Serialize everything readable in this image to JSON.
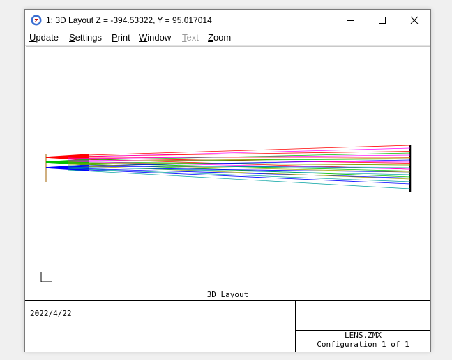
{
  "window": {
    "title": "1: 3D Layout Z = -394.53322, Y = 95.017014",
    "app_icon": "zemax-app-icon",
    "controls": [
      "minimize-icon",
      "maximize-icon",
      "close-icon"
    ]
  },
  "menu": {
    "items": [
      {
        "accel": "U",
        "rest": "pdate",
        "enabled": true
      },
      {
        "accel": "S",
        "rest": "ettings",
        "enabled": true
      },
      {
        "accel": "P",
        "rest": "rint",
        "enabled": true
      },
      {
        "accel": "W",
        "rest": "indow",
        "enabled": true
      },
      {
        "accel": "T",
        "rest": "ext",
        "enabled": false
      },
      {
        "accel": "Z",
        "rest": "oom",
        "enabled": true
      }
    ]
  },
  "colors": {
    "field1": "#ff0000",
    "field2": "#00c000",
    "field3": "#0000ff",
    "extra1": "#ff00ff",
    "extra2": "#a0a000",
    "extra3": "#00a0a0",
    "lens": "#a06000",
    "image_plane": "#000000"
  },
  "footer": {
    "title": "3D Layout",
    "date": "2022/4/22",
    "filename": "LENS.ZMX",
    "configuration": "Configuration 1 of 1"
  }
}
